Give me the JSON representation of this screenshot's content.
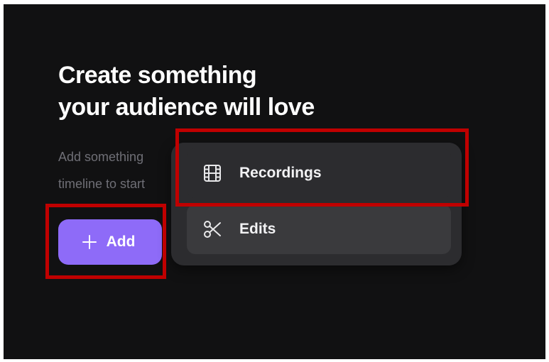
{
  "hero": {
    "title_line1": "Create something",
    "title_line2": "your audience will love",
    "description_line1": "Add something",
    "description_line2": "timeline to start"
  },
  "add_button": {
    "icon": "plus-icon",
    "label": "Add",
    "color": "#8e6bf8"
  },
  "add_menu": {
    "items": [
      {
        "icon": "film-icon",
        "label": "Recordings"
      },
      {
        "icon": "scissors-icon",
        "label": "Edits"
      }
    ]
  },
  "highlights": {
    "color": "#c00000"
  }
}
